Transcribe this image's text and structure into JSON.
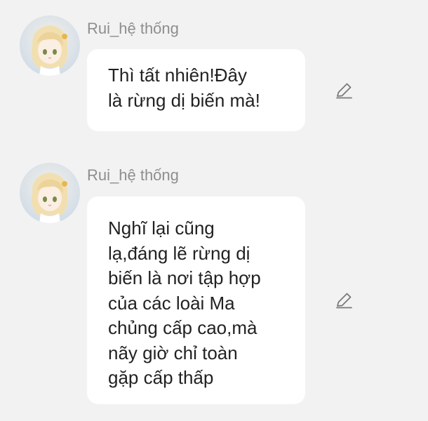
{
  "messages": [
    {
      "sender": "Rui_hệ thống",
      "text": "Thì tất nhiên!Đây\nlà rừng dị biến mà!",
      "avatar_icon": "anime-girl-avatar",
      "edit_icon": "pencil-icon"
    },
    {
      "sender": "Rui_hệ thống",
      "text": "Nghĩ lại cũng\nlạ,đáng lẽ rừng dị\nbiến là nơi tập hợp\ncủa các loài Ma\nchủng cấp cao,mà\nnãy giờ chỉ toàn\ngặp cấp thấp",
      "avatar_icon": "anime-girl-avatar",
      "edit_icon": "pencil-icon"
    }
  ],
  "colors": {
    "background": "#f2f2f2",
    "bubble": "#ffffff",
    "sender_text": "#8e8e8e",
    "message_text": "#222222",
    "icon": "#7a7a7a"
  }
}
